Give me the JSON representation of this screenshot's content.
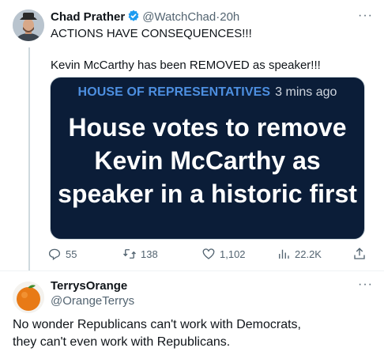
{
  "tweet": {
    "author_name": "Chad Prather",
    "author_handle": "@WatchChad",
    "separator": "·",
    "time": "20h",
    "line1": "ACTIONS HAVE CONSEQUENCES!!!",
    "line2": "Kevin McCarthy has been REMOVED as speaker!!!",
    "card": {
      "section": "HOUSE OF REPRESENTATIVES",
      "time": "3 mins ago",
      "headline": "House votes to remove Kevin McCarthy as speaker in a historic first"
    },
    "actions": {
      "replies": "55",
      "retweets": "138",
      "likes": "1,102",
      "views": "22.2K"
    }
  },
  "reply": {
    "author_name": "TerrysOrange",
    "author_handle": "@OrangeTerrys",
    "text_line1": "No wonder Republicans can't work with Democrats,",
    "text_line2": "they can't even work with Republicans."
  },
  "colors": {
    "verified_blue": "#1d9bf0",
    "card_background": "#0b1d38",
    "card_section": "#4d8fe0",
    "muted_text": "#536471"
  },
  "icons": [
    "verified-badge-icon",
    "more-icon",
    "reply-icon",
    "retweet-icon",
    "like-icon",
    "views-icon",
    "share-icon"
  ]
}
